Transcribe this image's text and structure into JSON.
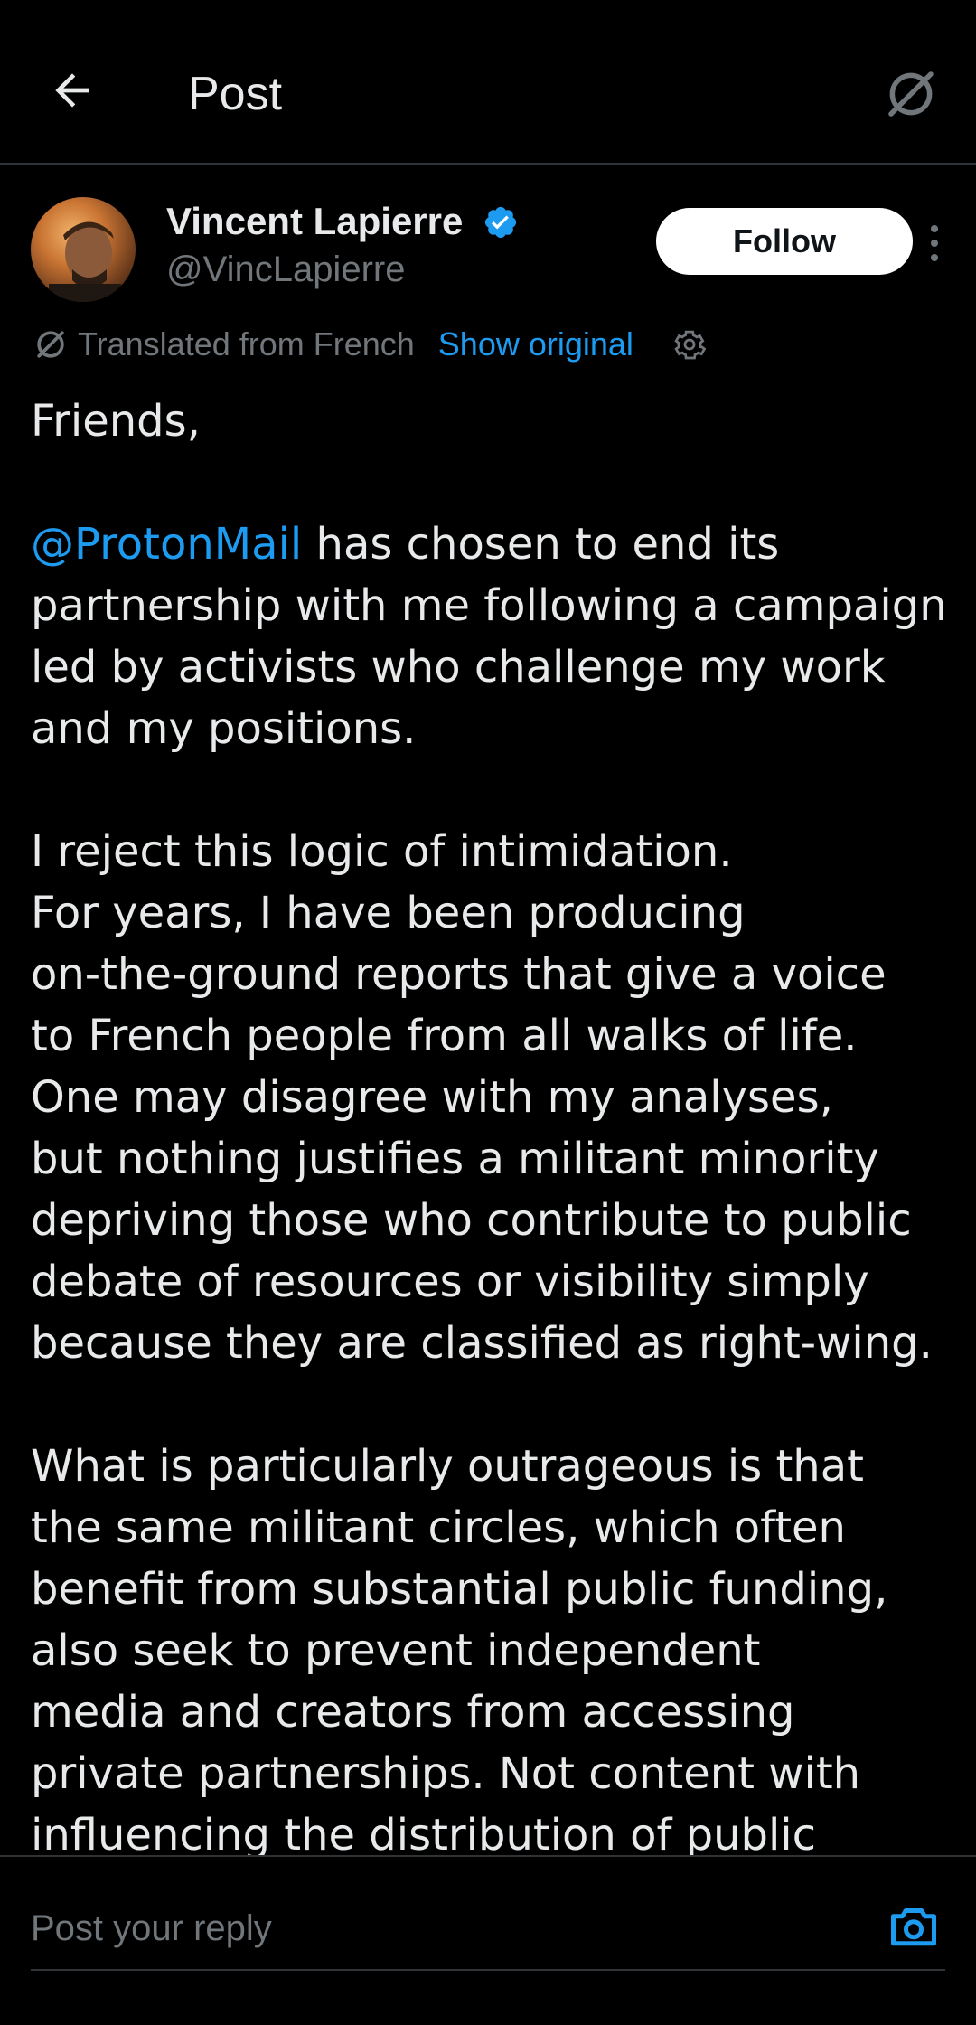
{
  "header": {
    "title": "Post",
    "back_icon": "arrow-left-icon",
    "translate_icon": "translate-icon"
  },
  "author": {
    "name": "Vincent Lapierre",
    "handle": "@VincLapierre",
    "verified_icon": "verified-badge-icon",
    "follow_label": "Follow"
  },
  "translation": {
    "text": "Translated from French",
    "show_original": "Show original"
  },
  "post": {
    "lines": [
      "Friends,",
      "",
      "@ProtonMail has chosen to end its",
      "partnership with me following a campaign",
      "led by activists who challenge my work",
      "and my positions.",
      "",
      "I reject this logic of intimidation.",
      "For years, I have been producing",
      "on-the-ground reports that give a voice",
      "to French people from all walks of life.",
      "One may disagree with my analyses,",
      "but nothing justifies a militant minority",
      "depriving those who contribute to public",
      "debate of resources or visibility simply",
      "because they are classified as right-wing.",
      "",
      "What is particularly outrageous is that",
      "the same militant circles, which often",
      "benefit from substantial public funding,",
      "also seek to prevent independent",
      "media and creators from accessing",
      "private partnerships. Not content with",
      "influencing the distribution of public"
    ],
    "mention": "@ProtonMail"
  },
  "reply": {
    "placeholder": "Post your reply",
    "camera_icon": "camera-icon"
  },
  "colors": {
    "background": "#000000",
    "text": "#e7e9ea",
    "muted": "#71767b",
    "accent": "#1d9bf0",
    "divider": "#2f3336"
  }
}
